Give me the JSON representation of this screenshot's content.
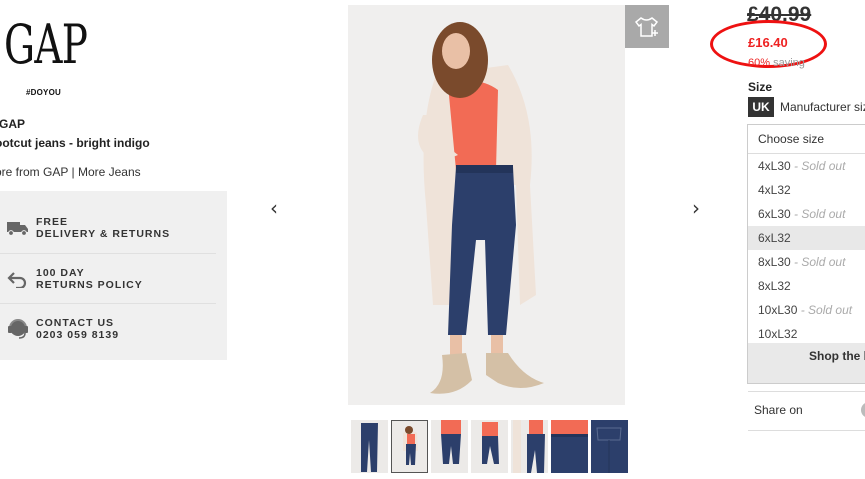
{
  "brand": {
    "logo_text": "GAP",
    "tagline": "#DOYOU"
  },
  "product": {
    "brand_line": "GAP",
    "name": "ootcut jeans - bright indigo",
    "more_from": "ore from GAP",
    "separator": "|",
    "more_category": "More Jeans"
  },
  "info": [
    {
      "icon": "truck-icon",
      "line1": "FREE",
      "line2": "DELIVERY & RETURNS"
    },
    {
      "icon": "return-arrow-icon",
      "line1": "100 DAY",
      "line2": "RETURNS POLICY"
    },
    {
      "icon": "headset-icon",
      "line1": "CONTACT US",
      "line2": "0203 059 8139"
    }
  ],
  "gallery": {
    "prev": "‹",
    "next": "›",
    "thumb_count": 7,
    "active_index": 1
  },
  "pricing": {
    "old_price": "£40.99",
    "new_price": "£16.40",
    "saving_pct": "60%",
    "saving_label": " saving"
  },
  "size": {
    "label": "Size",
    "region": "UK",
    "manufacturer_label": "Manufacturer sizes",
    "choose": "Choose size",
    "options": [
      {
        "size": "4xL30",
        "note": " - Sold out"
      },
      {
        "size": "4xL32",
        "note": ""
      },
      {
        "size": "6xL30",
        "note": " - Sold out"
      },
      {
        "size": "6xL32",
        "note": ""
      },
      {
        "size": "8xL30",
        "note": " - Sold out"
      },
      {
        "size": "8xL32",
        "note": ""
      },
      {
        "size": "10xL30",
        "note": " - Sold out"
      },
      {
        "size": "10xL32",
        "note": ""
      }
    ],
    "selected_index": 3,
    "shop_the_look": "Shop the look"
  },
  "share": {
    "label": "Share on"
  },
  "colors": {
    "sale_red": "#e22222",
    "panel_grey": "#f0f0f0",
    "denim": "#2c3f6b",
    "top_coral": "#f26b55"
  }
}
